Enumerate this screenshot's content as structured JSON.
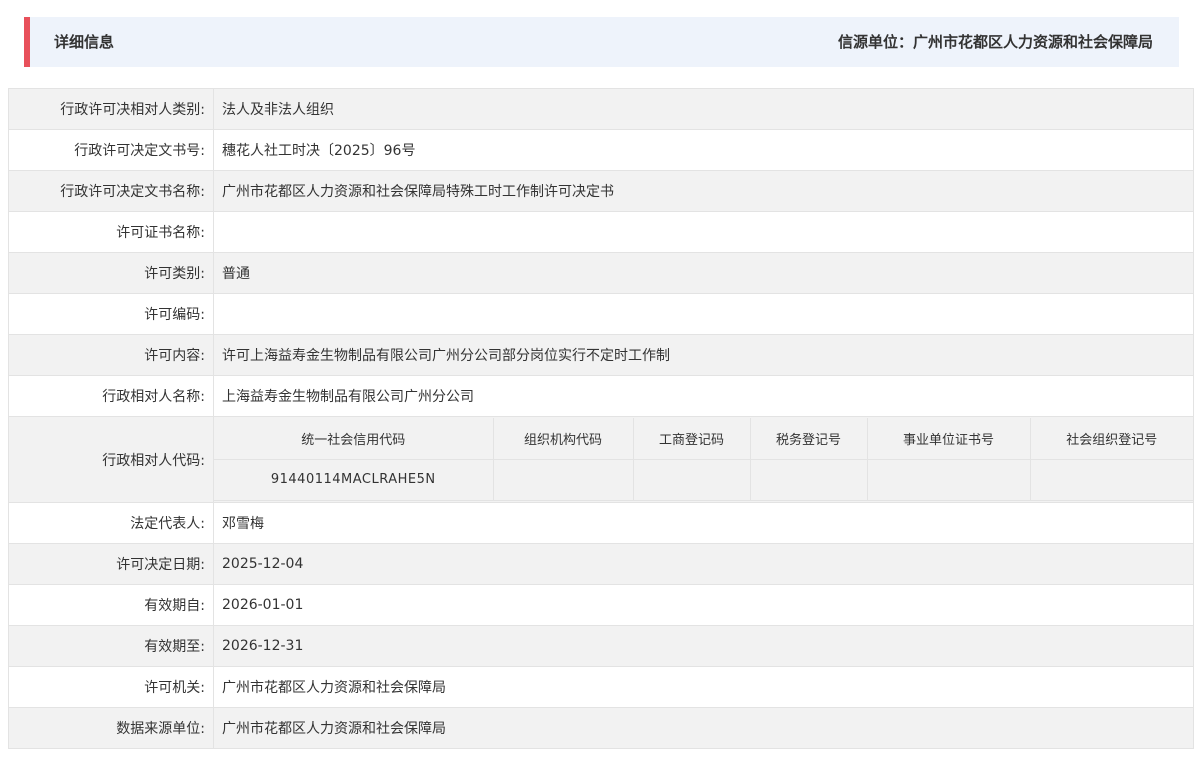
{
  "header": {
    "title": "详细信息",
    "source": "信源单位：广州市花都区人力资源和社会保障局",
    "accent_color": "#e8505b",
    "background_color": "#eef3fb"
  },
  "rows_top": [
    {
      "label": "行政许可决相对人类别:",
      "value": "法人及非法人组织"
    },
    {
      "label": "行政许可决定文书号:",
      "value": "穗花人社工时决〔2025〕96号"
    },
    {
      "label": "行政许可决定文书名称:",
      "value": "广州市花都区人力资源和社会保障局特殊工时工作制许可决定书"
    },
    {
      "label": "许可证书名称:",
      "value": ""
    },
    {
      "label": "许可类别:",
      "value": "普通"
    },
    {
      "label": "许可编码:",
      "value": ""
    },
    {
      "label": "许可内容:",
      "value": "许可上海益寿金生物制品有限公司广州分公司部分岗位实行不定时工作制"
    },
    {
      "label": "行政相对人名称:",
      "value": "上海益寿金生物制品有限公司广州分公司"
    }
  ],
  "codes": {
    "label": "行政相对人代码:",
    "headers": [
      "统一社会信用代码",
      "组织机构代码",
      "工商登记码",
      "税务登记号",
      "事业单位证书号",
      "社会组织登记号"
    ],
    "values": [
      "91440114MACLRAHE5N",
      "",
      "",
      "",
      "",
      ""
    ]
  },
  "rows_bottom": [
    {
      "label": "法定代表人:",
      "value": "邓雪梅"
    },
    {
      "label": "许可决定日期:",
      "value": "2025-12-04"
    },
    {
      "label": "有效期自:",
      "value": "2026-01-01"
    },
    {
      "label": "有效期至:",
      "value": "2026-12-31"
    },
    {
      "label": "许可机关:",
      "value": "广州市花都区人力资源和社会保障局"
    },
    {
      "label": "数据来源单位:",
      "value": "广州市花都区人力资源和社会保障局"
    }
  ]
}
